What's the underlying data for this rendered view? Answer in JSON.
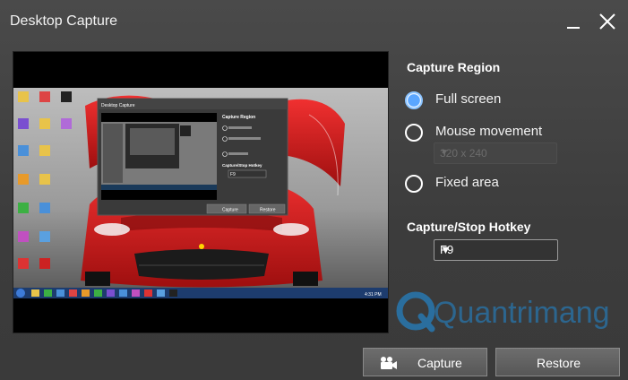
{
  "window": {
    "title": "Desktop Capture",
    "minimize_icon": "minimize-icon",
    "close_icon": "close-icon"
  },
  "capture_region": {
    "heading": "Capture Region",
    "options": [
      {
        "label": "Full screen",
        "checked": true
      },
      {
        "label": "Mouse movement",
        "checked": false
      },
      {
        "label": "Fixed area",
        "checked": false
      }
    ],
    "size_select": {
      "value": "320 x 240",
      "enabled": false
    }
  },
  "hotkey": {
    "heading": "Capture/Stop Hotkey",
    "value": "F9"
  },
  "preview": {
    "mini_window_title": "Desktop Capture",
    "mini_capture_label": "Capture",
    "mini_restore_label": "Restore",
    "mini_heading_region": "Capture Region",
    "mini_heading_hotkey": "Capture/Stop Hotkey",
    "mini_hotkey_value": "F9",
    "taskbar_time": "4:31 PM"
  },
  "watermark": {
    "text": "Quantrimang"
  },
  "buttons": {
    "capture_label": "Capture",
    "restore_label": "Restore",
    "capture_icon": "camera-icon"
  },
  "colors": {
    "accent": "#5aa6ff",
    "car_red": "#d21b1b",
    "watermark": "#1e5f8c"
  }
}
